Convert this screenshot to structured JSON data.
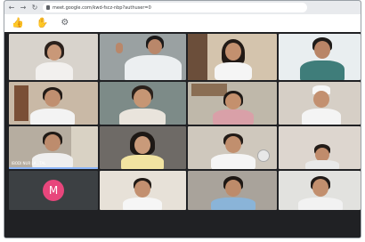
{
  "browser": {
    "url": "meet.google.com/kwd-fscz-nbp?authuser=0"
  },
  "reactions": {
    "thumbs_icon": "thumbs-up",
    "hand_icon": "raised-hand",
    "settings_icon": "gear"
  },
  "participants": [
    {
      "name": ""
    },
    {
      "name": ""
    },
    {
      "name": ""
    },
    {
      "name": ""
    },
    {
      "name": ""
    },
    {
      "name": ""
    },
    {
      "name": ""
    },
    {
      "name": ""
    },
    {
      "name": ""
    },
    {
      "name": "IBODI NUR LA ..TAL",
      "active": true
    },
    {
      "name": ""
    },
    {
      "name": ""
    },
    {
      "name": ""
    },
    {
      "name": ""
    },
    {
      "name": ""
    },
    {
      "name": ""
    },
    {
      "name": ""
    }
  ],
  "avatar_participant": {
    "initial": "M",
    "color": "#e8467c"
  },
  "colors": {
    "background": "#202124",
    "active_speaker": "#8ab4f8"
  }
}
